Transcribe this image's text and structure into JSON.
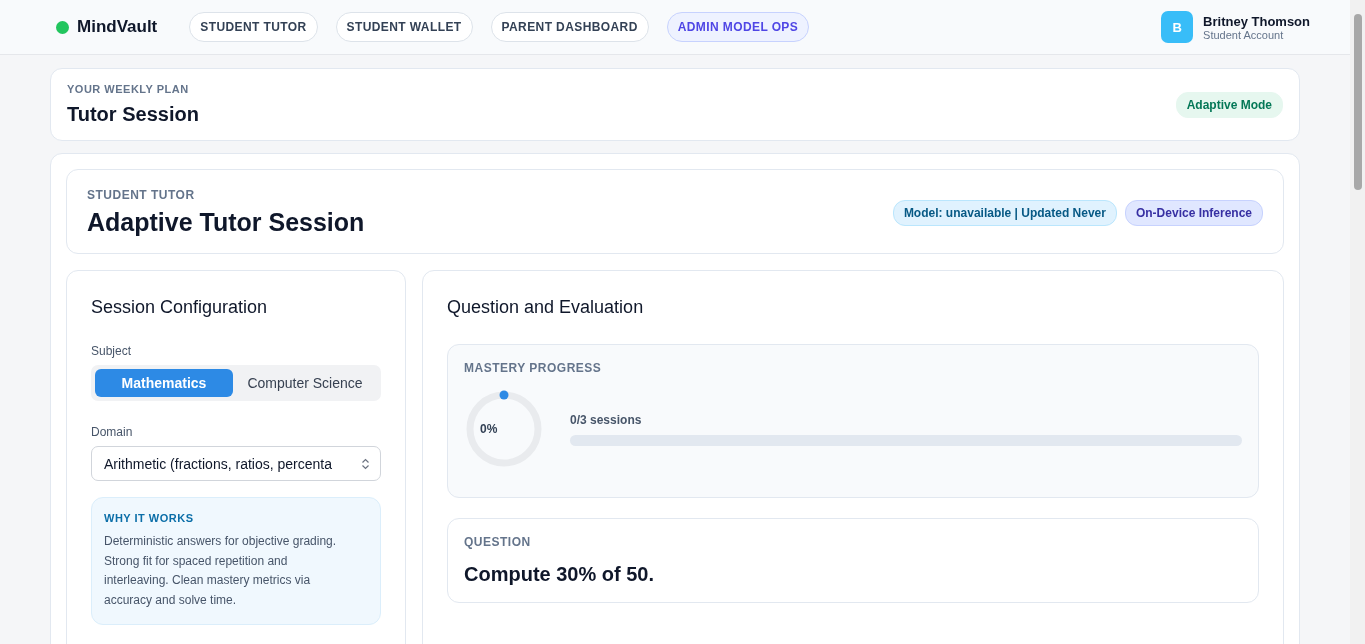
{
  "brand": {
    "name": "MindVault"
  },
  "nav": [
    {
      "label": "STUDENT TUTOR",
      "selected": false
    },
    {
      "label": "STUDENT WALLET",
      "selected": false
    },
    {
      "label": "PARENT DASHBOARD",
      "selected": false
    },
    {
      "label": "ADMIN MODEL OPS",
      "selected": true
    }
  ],
  "user": {
    "initial": "B",
    "name": "Britney Thomson",
    "role": "Student Account"
  },
  "plan": {
    "eyebrow": "YOUR WEEKLY PLAN",
    "title": "Tutor Session",
    "badge": "Adaptive Mode"
  },
  "session_header": {
    "eyebrow": "STUDENT TUTOR",
    "title": "Adaptive Tutor Session",
    "badges": [
      {
        "label": "Model: unavailable | Updated Never",
        "kind": "info"
      },
      {
        "label": "On-Device Inference",
        "kind": "accent"
      }
    ]
  },
  "config": {
    "title": "Session Configuration",
    "subject_label": "Subject",
    "subjects": [
      {
        "label": "Mathematics",
        "selected": true
      },
      {
        "label": "Computer Science",
        "selected": false
      }
    ],
    "domain_label": "Domain",
    "domain_value": "Arithmetic (fractions, ratios, percenta",
    "why": {
      "title": "WHY IT WORKS",
      "text": "Deterministic answers for objective grading. Strong fit for spaced repetition and interleaving. Clean mastery metrics via accuracy and solve time."
    }
  },
  "evaluation": {
    "title": "Question and Evaluation",
    "mastery": {
      "title": "MASTERY PROGRESS",
      "percent": "0%",
      "level": 0,
      "sessions": {
        "text": "0/3 sessions",
        "level": 0
      }
    },
    "question": {
      "title": "QUESTION",
      "text": "Compute 30% of 50."
    }
  }
}
